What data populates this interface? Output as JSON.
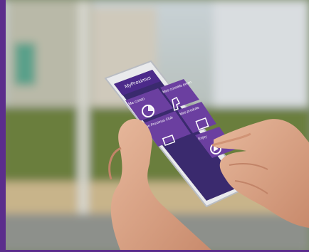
{
  "app": {
    "header_title": "MyProximus",
    "tiles": [
      {
        "label": "Ma conso",
        "icon": "pie-chart-icon"
      },
      {
        "label": "Mes conseils perso",
        "icon": "hand-pointer-icon"
      },
      {
        "label": "Mon Proximus Club",
        "icon": "gift-icon"
      },
      {
        "label": "Mes produits",
        "icon": "list-document-icon"
      },
      {
        "label": "Enjoy",
        "icon": "play-circle-icon"
      }
    ]
  },
  "colors": {
    "brand_purple": "#5b2d8c",
    "tile_purple": "#6b3fa0",
    "header_purple": "#4c2a8a"
  }
}
